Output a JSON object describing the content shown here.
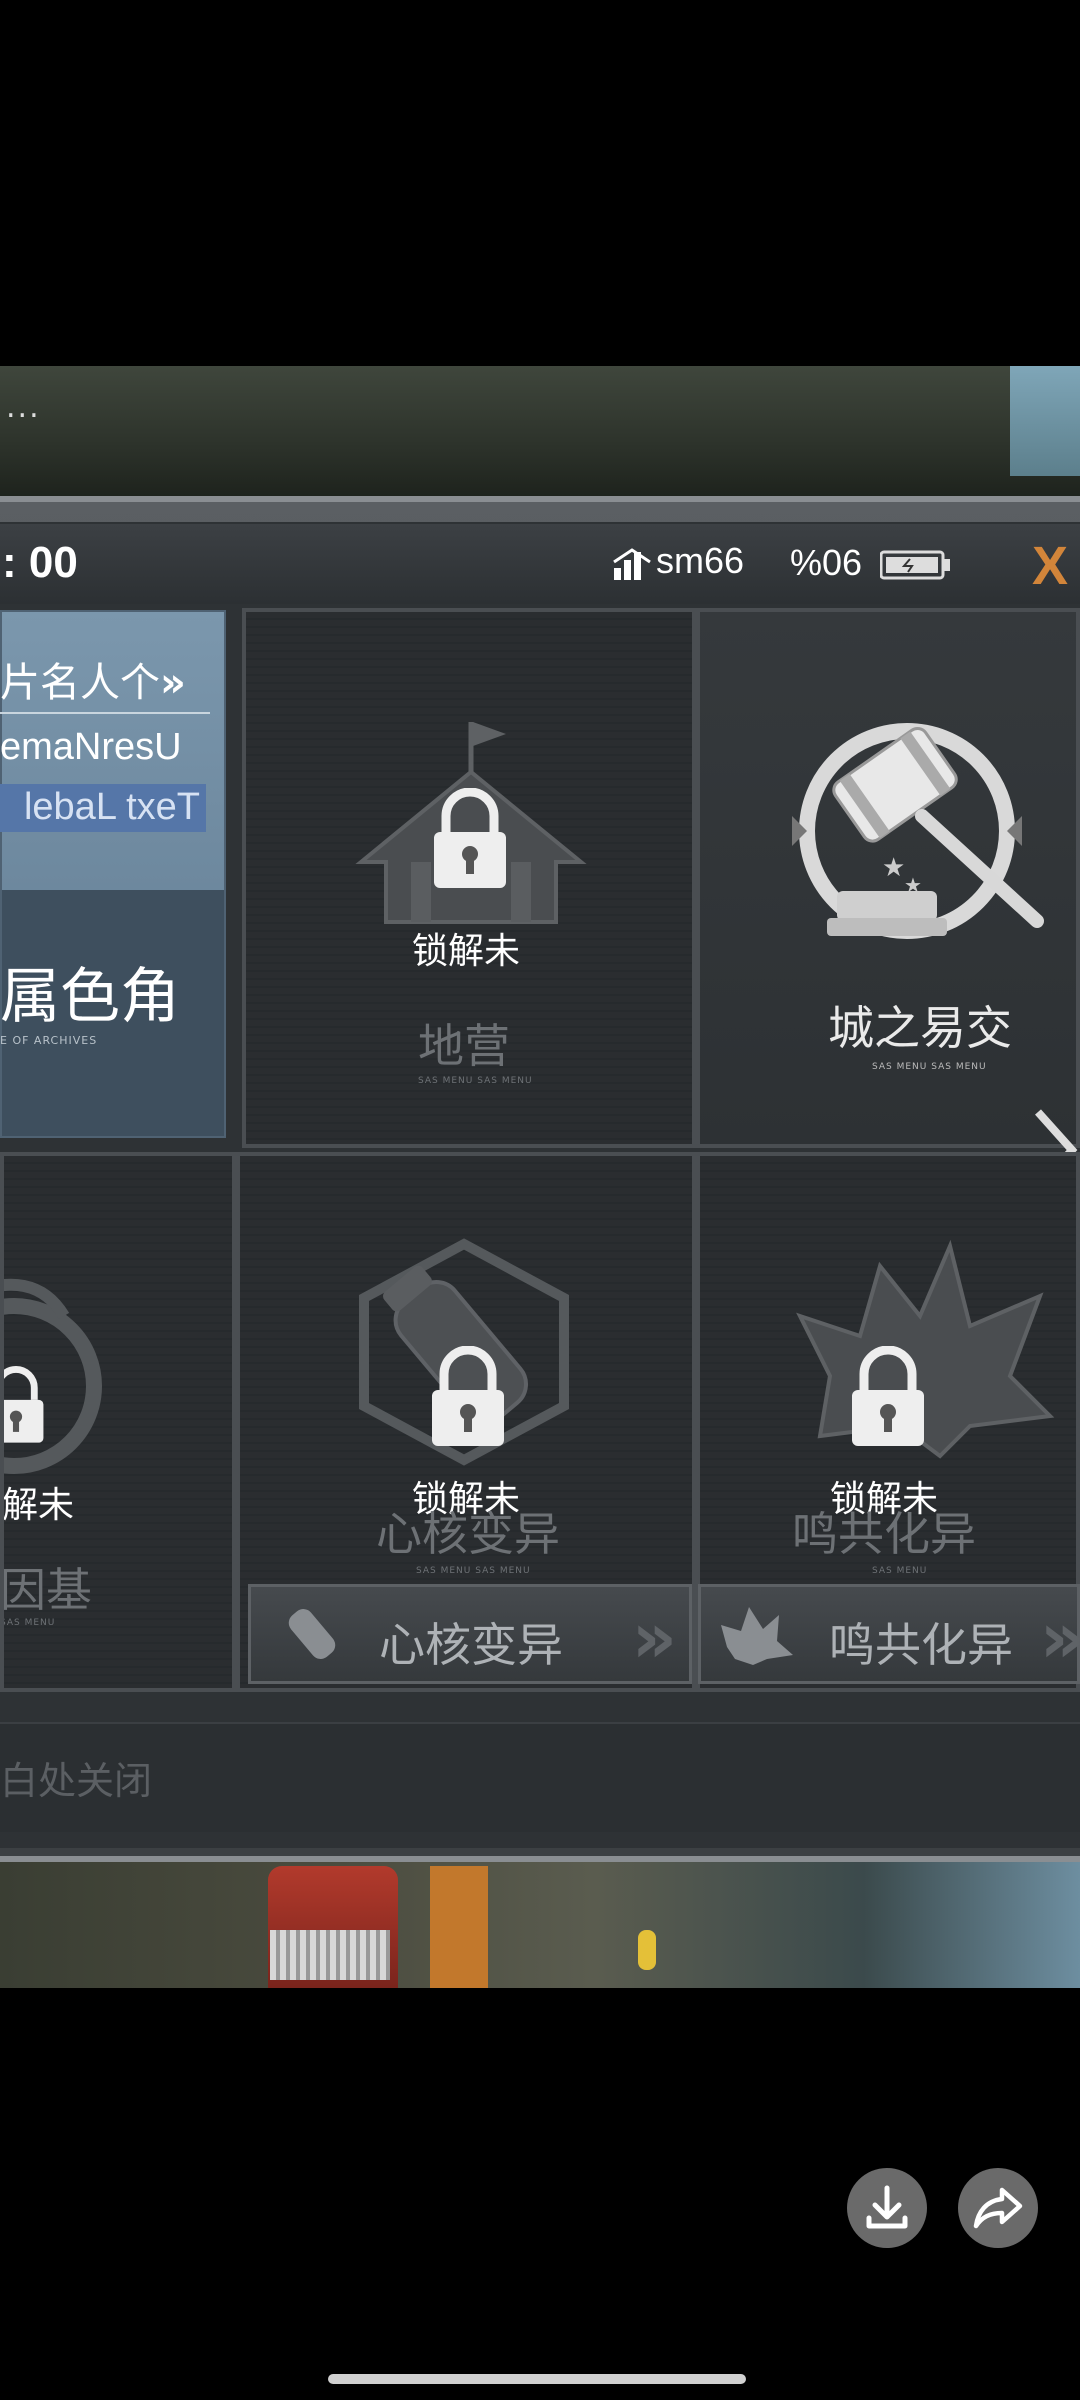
{
  "overlay": {
    "dots": "..."
  },
  "status": {
    "time": ": 00",
    "network": "sm66",
    "battery": "%06",
    "close_label": "X"
  },
  "profile": {
    "link": "片名人个",
    "username": "emaNresU",
    "text_label": "lebaL txeT",
    "role": "属色角",
    "role_sub": "E OF ARCHIVES"
  },
  "tiles": {
    "camp": {
      "locked": "锁解未",
      "title": "地营",
      "sub": "SAS MENU SAS MENU"
    },
    "trade": {
      "title": "城之易交",
      "sub": "SAS MENU SAS MENU"
    },
    "gene": {
      "locked": "解未",
      "title": "因基",
      "sub": "SAS MENU"
    },
    "core": {
      "locked": "锁解未",
      "title": "心核变异",
      "sub": "SAS MENU SAS MENU",
      "button": "心核变异"
    },
    "sym": {
      "locked": "锁解未",
      "title": "鸣共化异",
      "sub": "SAS MENU",
      "button": "鸣共化异"
    }
  },
  "footer": {
    "text": "白处关闭"
  },
  "colors": {
    "accent": "#d2853a",
    "panel": "#2e3235",
    "profile": "#6d889e",
    "label_bg": "#5576a8"
  }
}
